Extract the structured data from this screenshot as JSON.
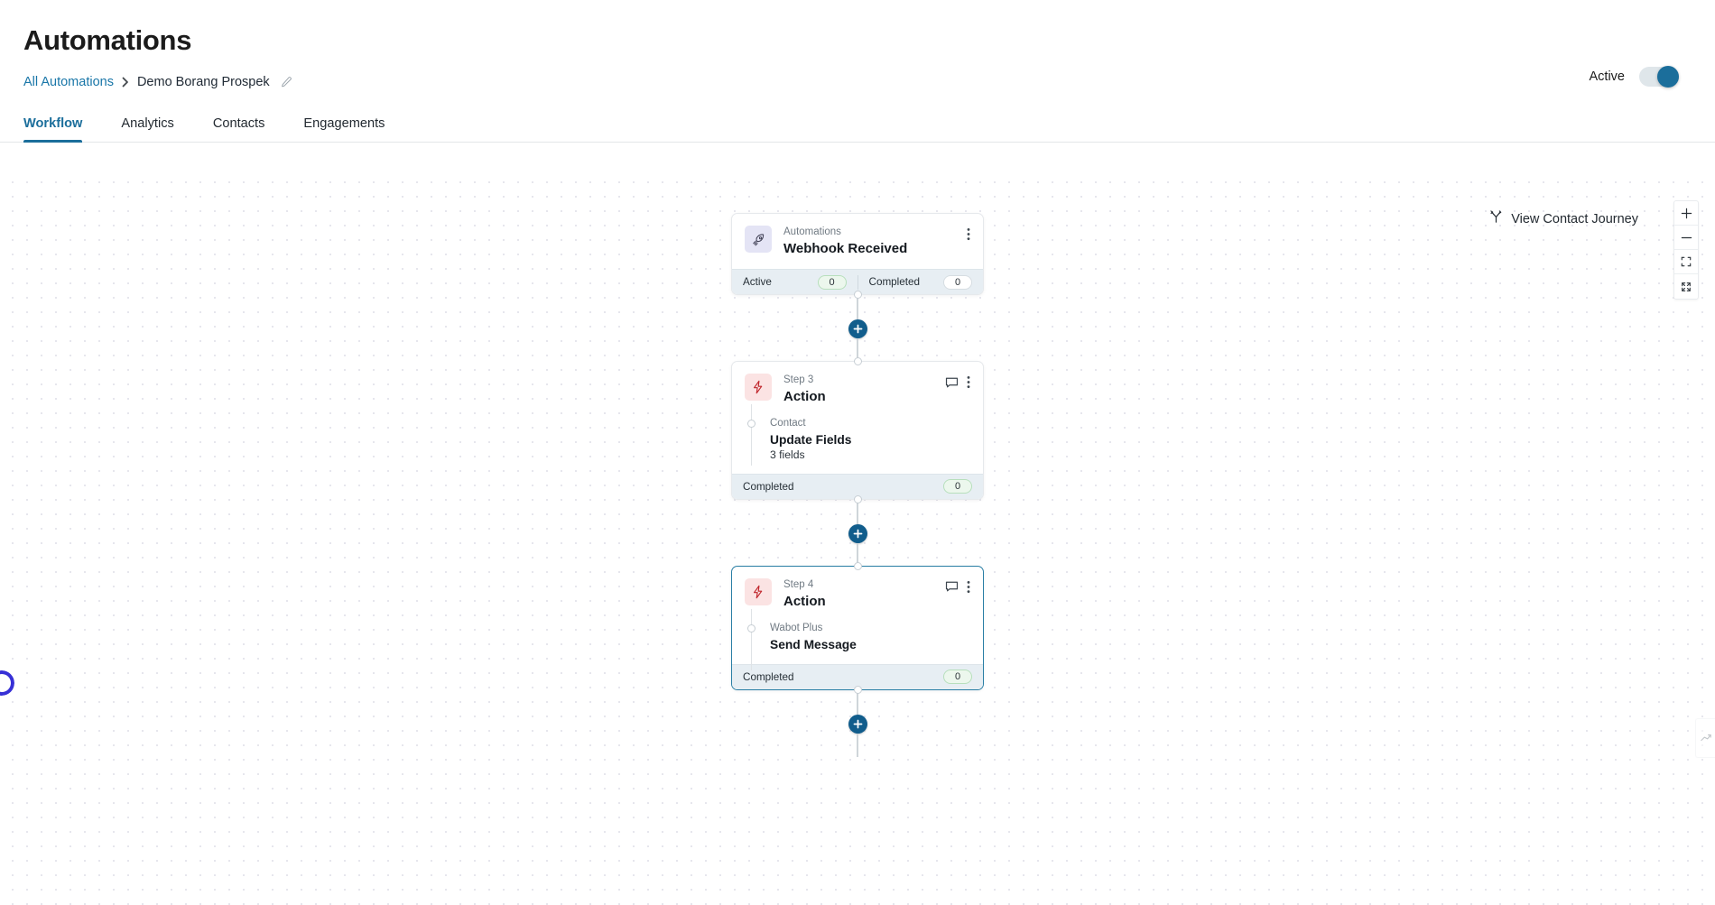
{
  "header": {
    "title": "Automations",
    "breadcrumb": {
      "root": "All Automations",
      "separator": "›",
      "current": "Demo Borang Prospek",
      "edit_icon": "pencil-icon"
    },
    "status_toggle": {
      "label": "Active",
      "enabled": true,
      "color": "#1b6e9b"
    }
  },
  "tabs": [
    {
      "label": "Workflow",
      "active": true
    },
    {
      "label": "Analytics",
      "active": false
    },
    {
      "label": "Contacts",
      "active": false
    },
    {
      "label": "Engagements",
      "active": false
    }
  ],
  "canvas": {
    "journey_button": {
      "label": "View Contact Journey",
      "icon": "branch-icon"
    },
    "zoom_controls": [
      {
        "name": "zoom-in",
        "glyph": "+"
      },
      {
        "name": "zoom-out",
        "glyph": "−"
      },
      {
        "name": "fit-view",
        "glyph": "fit-icon"
      },
      {
        "name": "full-screen",
        "glyph": "expand-icon"
      }
    ],
    "minimap_toggle": "minimap-icon",
    "loading_spinner": {
      "visible": true,
      "color": "#3730d6"
    }
  },
  "nodes": [
    {
      "id": "trigger",
      "icon": "rocket-icon",
      "icon_style": "trigger",
      "kicker": "Automations",
      "title": "Webhook Received",
      "has_comment": false,
      "selected": false,
      "body": null,
      "footer": [
        {
          "label": "Active",
          "value": "0",
          "pill": "green"
        },
        {
          "label": "Completed",
          "value": "0",
          "pill": "plain"
        }
      ]
    },
    {
      "id": "step3",
      "icon": "lightning-icon",
      "icon_style": "action",
      "kicker": "Step 3",
      "title": "Action",
      "has_comment": true,
      "selected": false,
      "body": {
        "kicker": "Contact",
        "title": "Update Fields",
        "sub": "3 fields"
      },
      "footer": [
        {
          "label": "Completed",
          "value": "0",
          "pill": "green"
        }
      ]
    },
    {
      "id": "step4",
      "icon": "lightning-icon",
      "icon_style": "action",
      "kicker": "Step 4",
      "title": "Action",
      "has_comment": true,
      "selected": true,
      "body": {
        "kicker": "Wabot Plus",
        "title": "Send Message",
        "sub": ""
      },
      "footer": [
        {
          "label": "Completed",
          "value": "0",
          "pill": "green"
        }
      ]
    }
  ],
  "add_buttons": {
    "glyph": "+",
    "count": 3
  },
  "colors": {
    "accent": "#1b6e9b",
    "add_button": "#115d8c",
    "footer_bg": "#e7eef3",
    "trigger_icon_bg": "#e4e4f5",
    "action_icon_bg": "#fbe3e3",
    "action_icon_fg": "#c0272d"
  }
}
